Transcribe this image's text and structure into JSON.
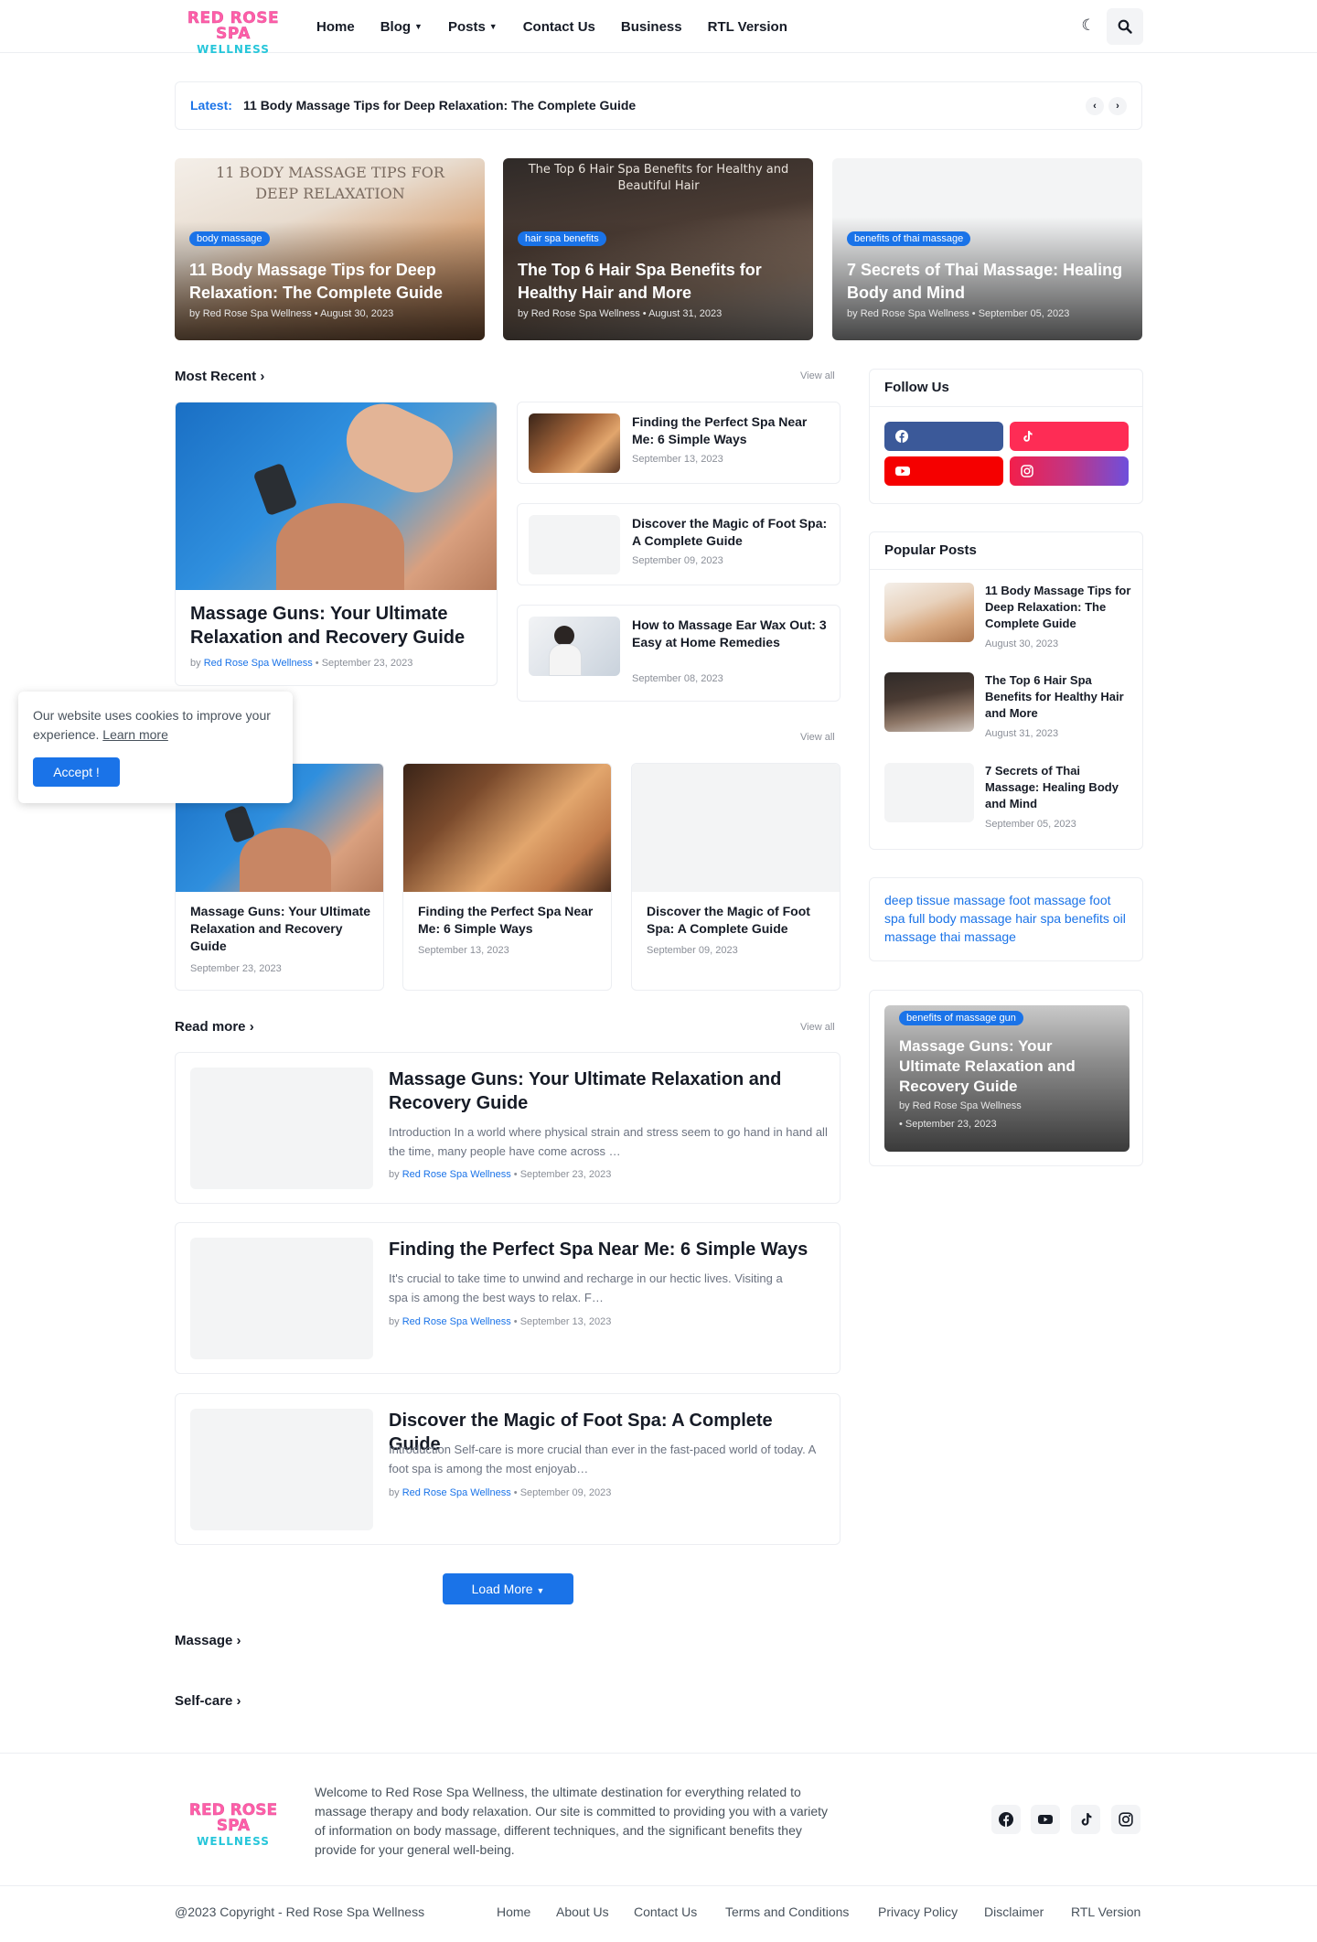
{
  "brand": {
    "line1": "RED ROSE SPA",
    "line2": "WELLNESS"
  },
  "nav": [
    {
      "label": "Home"
    },
    {
      "label": "Blog",
      "has_dropdown": true
    },
    {
      "label": "Posts",
      "has_dropdown": true
    },
    {
      "label": "Contact Us"
    },
    {
      "label": "Business"
    },
    {
      "label": "RTL Version"
    }
  ],
  "icons": {
    "dark_mode": "moon-icon",
    "search": "search-icon"
  },
  "ticker": {
    "label": "Latest:",
    "text": "11 Body Massage Tips for Deep Relaxation: The Complete Guide",
    "prev": "‹",
    "next": "›"
  },
  "featured": [
    {
      "tag": "body massage",
      "title": "11 Body Massage Tips for Deep Relaxation: The Complete Guide",
      "author": "Red Rose Spa Wellness",
      "date": "August 30, 2023",
      "image_text": "11 BODY MASSAGE TIPS FOR DEEP RELAXATION"
    },
    {
      "tag": "hair spa benefits",
      "title": "The Top 6 Hair Spa Benefits for Healthy Hair and More",
      "author": "Red Rose Spa Wellness",
      "date": "August 31, 2023",
      "image_text": "The Top 6 Hair Spa Benefits for Healthy and Beautiful Hair"
    },
    {
      "tag": "benefits of thai massage",
      "title": "7 Secrets of Thai Massage: Healing Body and Mind",
      "author": "Red Rose Spa Wellness",
      "date": "September 05, 2023"
    }
  ],
  "most_recent": {
    "heading": "Most Recent",
    "view_all": "View all",
    "main": {
      "title": "Massage Guns: Your Ultimate Relaxation and Recovery Guide",
      "by": "by",
      "author": "Red Rose Spa Wellness",
      "date": "September 23, 2023"
    },
    "list": [
      {
        "title": "Finding the Perfect Spa Near Me: 6 Simple Ways",
        "date": "September 13, 2023"
      },
      {
        "title": "Discover the Magic of Foot Spa: A Complete Guide",
        "date": "September 09, 2023"
      },
      {
        "title": "How to Massage Ear Wax Out: 3 Easy at Home Remedies",
        "date": "September 08, 2023"
      }
    ]
  },
  "grid_section": {
    "view_all": "View all",
    "items": [
      {
        "title": "Massage Guns: Your Ultimate Relaxation and Recovery Guide",
        "date": "September 23, 2023"
      },
      {
        "title": "Finding the Perfect Spa Near Me: 6 Simple Ways",
        "date": "September 13, 2023"
      },
      {
        "title": "Discover the Magic of Foot Spa: A Complete Guide",
        "date": "September 09, 2023"
      }
    ]
  },
  "read_more": {
    "heading": "Read more",
    "view_all": "View all",
    "items": [
      {
        "title": "Massage Guns: Your Ultimate Relaxation and Recovery Guide",
        "snippet": "Introduction In a world where physical strain and stress seem to go hand in hand all the time, many people have come across …",
        "author": "Red Rose Spa Wellness",
        "date": "September 23, 2023"
      },
      {
        "title": "Finding the Perfect Spa Near Me: 6 Simple Ways",
        "snippet": "It's crucial to take time to unwind and recharge in our hectic lives. Visiting a spa is among the best ways to relax. F…",
        "author": "Red Rose Spa Wellness",
        "date": "September 13, 2023"
      },
      {
        "title": "Discover the Magic of Foot Spa: A Complete Guide",
        "snippet": "Introduction Self-care is more crucial than ever in the fast-paced world of today. A foot spa is among the most enjoyab…",
        "author": "Red Rose Spa Wellness",
        "date": "September 09, 2023"
      }
    ],
    "load_more": "Load More"
  },
  "categories": [
    {
      "label": "Massage"
    },
    {
      "label": "Self-care"
    }
  ],
  "cookie": {
    "text": "Our website uses cookies to improve your experience.",
    "learn_more": "Learn more",
    "accept": "Accept !"
  },
  "sidebar": {
    "follow_heading": "Follow Us",
    "social": [
      {
        "name": "facebook",
        "color": "#3b5999"
      },
      {
        "name": "tiktok",
        "color": "#fe2c55"
      },
      {
        "name": "youtube",
        "color": "#f50000"
      },
      {
        "name": "instagram",
        "color": "#c13584"
      }
    ],
    "popular_heading": "Popular Posts",
    "popular": [
      {
        "title": "11 Body Massage Tips for Deep Relaxation: The Complete Guide",
        "date": "August 30, 2023"
      },
      {
        "title": "The Top 6 Hair Spa Benefits for Healthy Hair and More",
        "date": "August 31, 2023"
      },
      {
        "title": "7 Secrets of Thai Massage: Healing Body and Mind",
        "date": "September 05, 2023"
      }
    ],
    "tags": [
      "deep tissue massage",
      "foot massage",
      "foot spa",
      "full body massage",
      "hair spa benefits",
      "oil massage",
      "thai massage"
    ],
    "feature": {
      "tag": "benefits of massage gun",
      "title": "Massage Guns: Your Ultimate Relaxation and Recovery Guide",
      "author": "by Red Rose Spa Wellness",
      "date": "• September 23, 2023"
    }
  },
  "footer": {
    "about": "Welcome to Red Rose Spa Wellness, the ultimate destination for everything related to massage therapy and body relaxation. Our site is committed to providing you with a variety of information on body massage, different techniques, and the significant benefits they provide for your general well-being.",
    "copyright": "@2023 Copyright - Red Rose Spa Wellness",
    "links": [
      {
        "label": "Home"
      },
      {
        "label": "About Us"
      },
      {
        "label": "Contact Us"
      },
      {
        "label": "Terms and Conditions"
      },
      {
        "label": "Privacy Policy"
      },
      {
        "label": "Disclaimer"
      },
      {
        "label": "RTL Version"
      }
    ]
  },
  "colors": {
    "accent": "#1a73e8",
    "text": "#161b26",
    "muted": "#8b8f98"
  }
}
